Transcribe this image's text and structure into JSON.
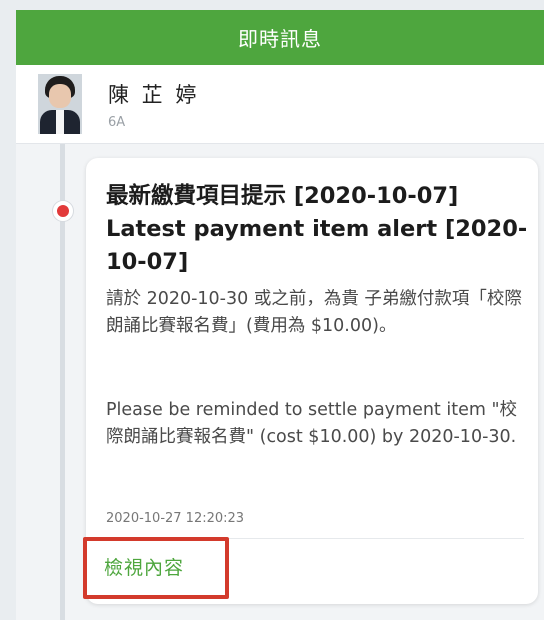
{
  "header": {
    "title": "即時訊息"
  },
  "profile": {
    "name": "陳 芷 婷",
    "class": "6A",
    "avatar_icon": "student-photo"
  },
  "message": {
    "title": "最新繳費項目提示 [2020-10-07] Latest payment item alert [2020-10-07]",
    "body_zh": "請於 2020-10-30 或之前，為貴 子弟繳付款項「校際朗誦比賽報名費」(費用為 $10.00)。",
    "body_en": "Please be reminded to settle payment item \"校際朗誦比賽報名費\" (cost $10.00) by 2020-10-30.",
    "timestamp": "2020-10-27 12:20:23",
    "action_label": "檢視內容",
    "unread_dot_color": "#e23a3a"
  },
  "colors": {
    "brand": "#4ea63e",
    "highlight": "#d33a2c"
  }
}
